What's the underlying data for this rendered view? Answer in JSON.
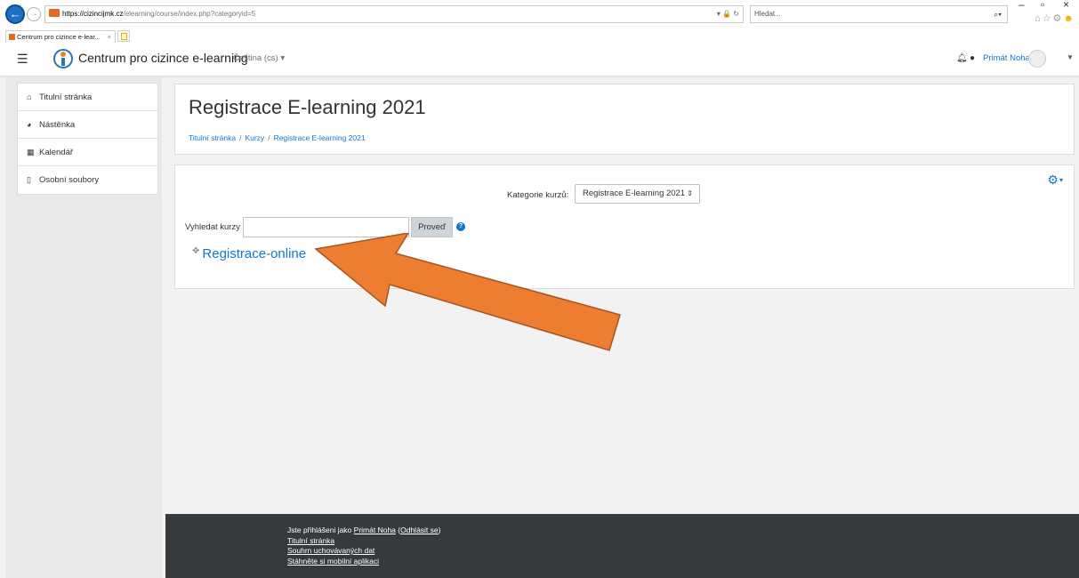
{
  "browser": {
    "url_host": "https://cizincijmk.cz",
    "url_path": "/elearning/course/index.php?categoryid=5",
    "search_placeholder": "Hledat...",
    "tab_title": "Centrum pro cizince e-lear...",
    "tab_close": "×"
  },
  "navbar": {
    "site_name": "Centrum pro cizince e-learning",
    "language": "Čeština (cs) ▾",
    "user_name": "Primát Noha"
  },
  "drawer": {
    "items": [
      {
        "label": "Titulní stránka",
        "icon": "home-icon"
      },
      {
        "label": "Nástěnka",
        "icon": "dashboard-icon"
      },
      {
        "label": "Kalendář",
        "icon": "calendar-icon"
      },
      {
        "label": "Osobní soubory",
        "icon": "file-icon"
      }
    ]
  },
  "header": {
    "title": "Registrace E-learning 2021",
    "breadcrumb": [
      "Titulní stránka",
      "Kurzy",
      "Registrace E-learning 2021"
    ],
    "separator": "/"
  },
  "content": {
    "category_label": "Kategorie kurzů:",
    "category_selected": "Registrace E-learning 2021",
    "search_label": "Vyhledat kurzy",
    "search_value": "",
    "go_label": "Proveď",
    "category_link": "Registrace-online"
  },
  "footer": {
    "logged_in_prefix": "Jste přihlášeni jako ",
    "logged_in_user": "Primát Noha",
    "logout_open": " (",
    "logout_label": "Odhlásit se",
    "logout_close": ")",
    "home_link": "Titulní stránka",
    "data_summary": "Souhrn uchovávaných dat",
    "mobile_app": "Stáhněte si mobilní aplikaci"
  },
  "colors": {
    "link": "#1177d1",
    "footer_bg": "#373a3c",
    "annotation_arrow": "#ed7d31"
  }
}
